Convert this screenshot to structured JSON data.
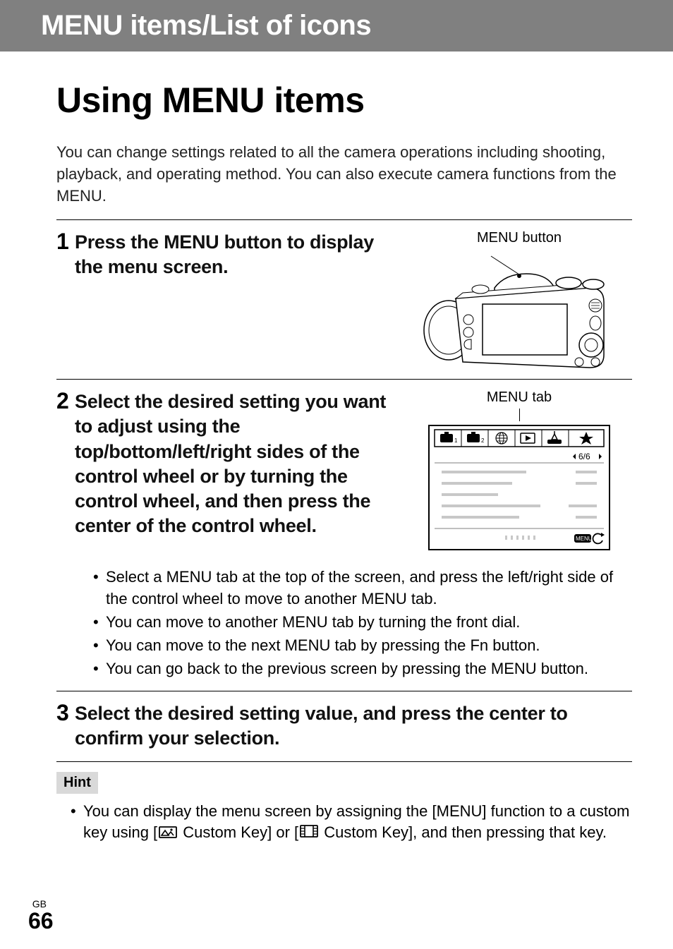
{
  "header": {
    "title": "MENU items/List of icons"
  },
  "main": {
    "title": "Using MENU items",
    "intro": "You can change settings related to all the camera operations including shooting, playback, and operating method. You can also execute camera functions from the MENU."
  },
  "step1": {
    "num": "1",
    "text": "Press the MENU button to display the menu screen.",
    "caption": "MENU button"
  },
  "step2": {
    "num": "2",
    "text": "Select the desired setting you want to adjust using the top/bottom/left/right sides of the control wheel or by turning the control wheel, and then press the center of the control wheel.",
    "caption": "MENU tab",
    "page_indicator": "6/6",
    "menu_icon_label": "MENU",
    "bullets": [
      "Select a MENU tab at the top of the screen, and press the left/right side of the control wheel to move to another MENU tab.",
      "You can move to another MENU tab by turning the front dial.",
      "You can move to the next MENU tab by pressing the Fn button.",
      "You can go back to the previous screen by pressing the MENU button."
    ]
  },
  "step3": {
    "num": "3",
    "text": "Select the desired setting value, and press the center to confirm your selection."
  },
  "hint": {
    "label": "Hint",
    "text_before": "You can display the menu screen by assigning the [MENU] function to a custom key using [",
    "text_mid": " Custom Key] or [",
    "text_after": " Custom Key], and then pressing that key."
  },
  "footer": {
    "region": "GB",
    "page": "66"
  }
}
